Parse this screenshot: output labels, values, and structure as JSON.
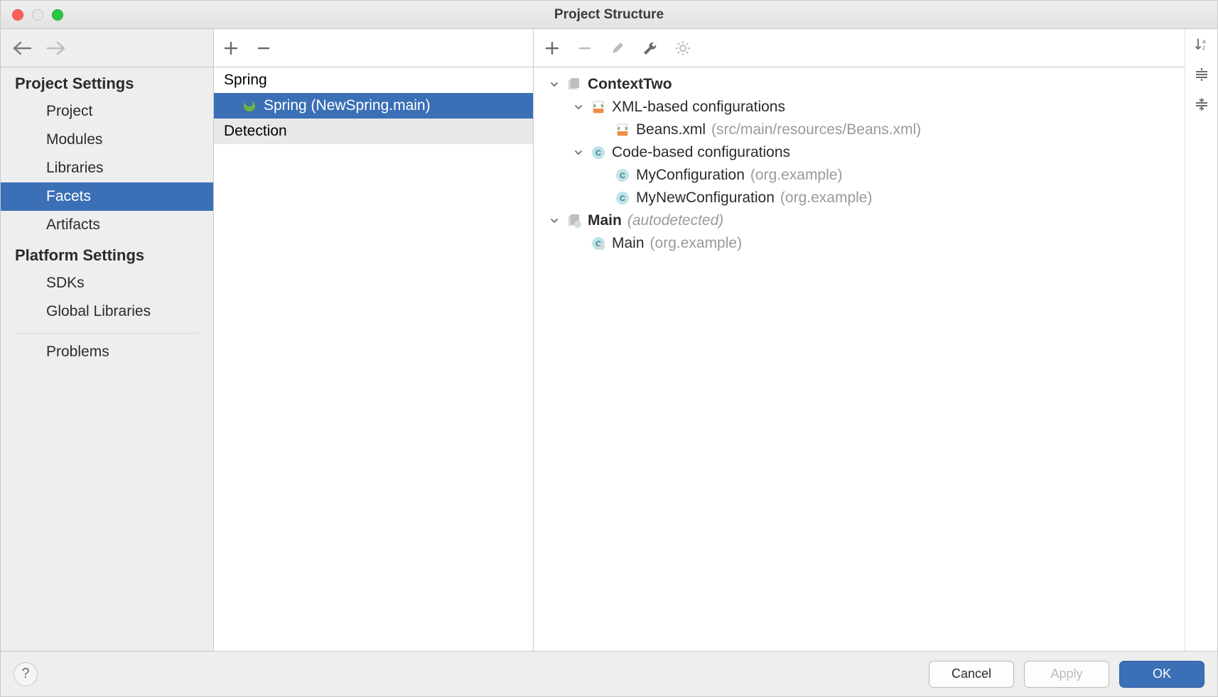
{
  "window": {
    "title": "Project Structure"
  },
  "sidebar": {
    "section1_title": "Project Settings",
    "items1": [
      "Project",
      "Modules",
      "Libraries",
      "Facets",
      "Artifacts"
    ],
    "selected1": "Facets",
    "section2_title": "Platform Settings",
    "items2": [
      "SDKs",
      "Global Libraries"
    ],
    "after_items": [
      "Problems"
    ]
  },
  "mid": {
    "rows": [
      {
        "label": "Spring",
        "level": 1
      },
      {
        "label": "Spring (NewSpring.main)",
        "level": 2,
        "selected": true,
        "icon": "spring"
      },
      {
        "label": "Detection",
        "level": 1,
        "variant": "detection"
      }
    ]
  },
  "right": {
    "tree": [
      {
        "indent": 0,
        "chev": true,
        "icon": "context",
        "label": "ContextTwo",
        "bold": true
      },
      {
        "indent": 1,
        "chev": true,
        "icon": "xml",
        "label": "XML-based configurations"
      },
      {
        "indent": 2,
        "chev": false,
        "icon": "xml",
        "label": "Beans.xml",
        "suffix": "(src/main/resources/Beans.xml)"
      },
      {
        "indent": 1,
        "chev": true,
        "icon": "class",
        "label": "Code-based configurations"
      },
      {
        "indent": 2,
        "chev": false,
        "icon": "class",
        "label": "MyConfiguration",
        "suffix": "(org.example)"
      },
      {
        "indent": 2,
        "chev": false,
        "icon": "class",
        "label": "MyNewConfiguration",
        "suffix": "(org.example)"
      },
      {
        "indent": 0,
        "chev": true,
        "icon": "context2",
        "label": "Main",
        "bold": true,
        "suffix_italic": "(autodetected)"
      },
      {
        "indent": 1,
        "chev": false,
        "icon": "class2",
        "label": "Main",
        "suffix": "(org.example)"
      }
    ]
  },
  "footer": {
    "cancel": "Cancel",
    "apply": "Apply",
    "ok": "OK"
  }
}
